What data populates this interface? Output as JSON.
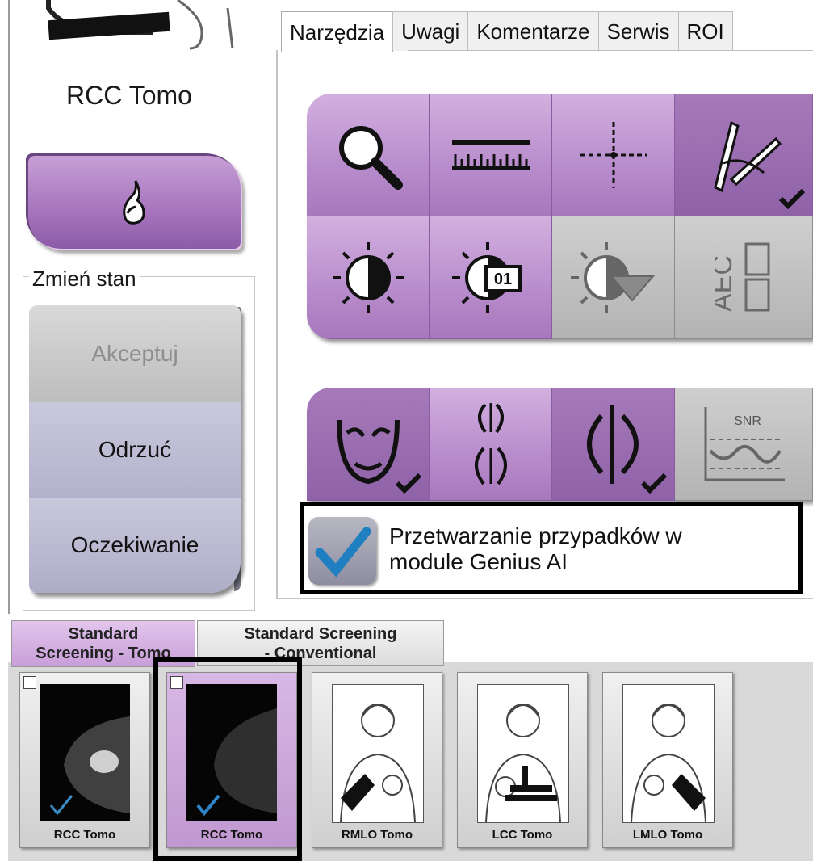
{
  "view": {
    "title": "RCC Tomo"
  },
  "status": {
    "legend": "Zmień stan",
    "accept": "Akceptuj",
    "reject": "Odrzuć",
    "pending": "Oczekiwanie"
  },
  "tabs": [
    "Narzędzia",
    "Uwagi",
    "Komentarze",
    "Serwis",
    "ROI"
  ],
  "tools": {
    "row1": [
      "magnifier-icon",
      "ruler-icon",
      "crosshair-icon",
      "annotation-tools-icon"
    ],
    "row2": [
      "contrast-icon",
      "contrast-01-icon",
      "window-level-presets-icon",
      "aec-icon"
    ],
    "aec_text": "AEC",
    "preset_text": "01",
    "row3": [
      "face-icon",
      "breast-outline-icon",
      "edge-icon",
      "snr-icon"
    ],
    "snr_text": "SNR"
  },
  "ai": {
    "label_line1": "Przetwarzanie przypadków w",
    "label_line2": "module Genius AI",
    "checked": true
  },
  "protocols": {
    "active": {
      "line1": "Standard",
      "line2": "Screening - Tomo"
    },
    "inactive": {
      "line1": "Standard Screening",
      "line2": "- Conventional"
    }
  },
  "thumbnails": [
    {
      "label": "RCC Tomo"
    },
    {
      "label": "RCC Tomo"
    },
    {
      "label": "RMLO Tomo"
    },
    {
      "label": "LCC Tomo"
    },
    {
      "label": "LMLO Tomo"
    }
  ],
  "colors": {
    "accent": "#b88ccc",
    "accent_dark": "#8f62a8",
    "disabled": "#bdbdbd"
  }
}
